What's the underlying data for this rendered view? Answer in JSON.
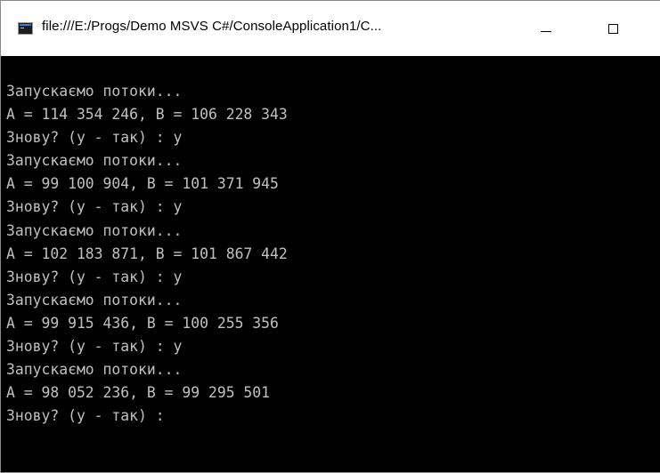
{
  "window": {
    "title": "file:///E:/Progs/Demo MSVS C#/ConsoleApplication1/C..."
  },
  "console": {
    "lines": [
      "Запускаємо потоки...",
      "A = 114 354 246, B = 106 228 343",
      "Знову? (y - так) : y",
      "Запускаємо потоки...",
      "A = 99 100 904, B = 101 371 945",
      "Знову? (y - так) : y",
      "Запускаємо потоки...",
      "A = 102 183 871, B = 101 867 442",
      "Знову? (y - так) : y",
      "Запускаємо потоки...",
      "A = 99 915 436, B = 100 255 356",
      "Знову? (y - так) : y",
      "Запускаємо потоки...",
      "A = 98 052 236, B = 99 295 501",
      "Знову? (y - так) :"
    ]
  }
}
